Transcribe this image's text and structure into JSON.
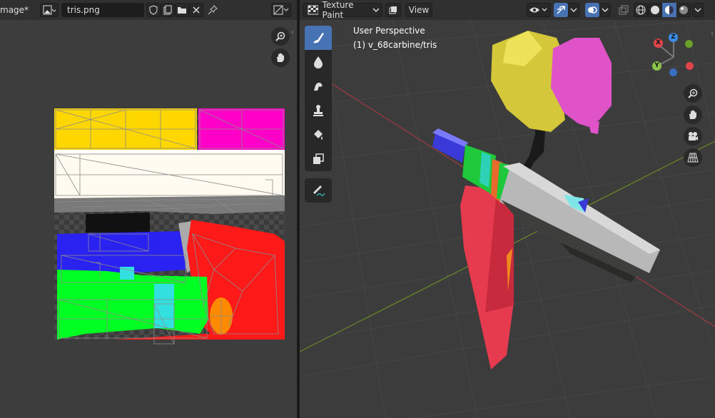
{
  "image_editor": {
    "header": {
      "mode_label": "mage*",
      "image_name": "tris.png"
    }
  },
  "viewport": {
    "header": {
      "mode": "Texture Paint",
      "view_menu": "View"
    },
    "overlay": {
      "perspective": "User Perspective",
      "object": "(1) v_68carbine/tris"
    },
    "gizmo": {
      "x_label": "X",
      "y_label": "Y",
      "z_label": "Z"
    },
    "tools": [
      "brush-icon",
      "blur-icon",
      "smear-icon",
      "clone-icon",
      "fill-icon",
      "mask-icon",
      "annotate-icon"
    ]
  },
  "colors": {
    "active_tool": "#4772b3",
    "x_axis": "#e2444c",
    "y_axis": "#8bc34a",
    "z_axis": "#3b8ee8"
  }
}
